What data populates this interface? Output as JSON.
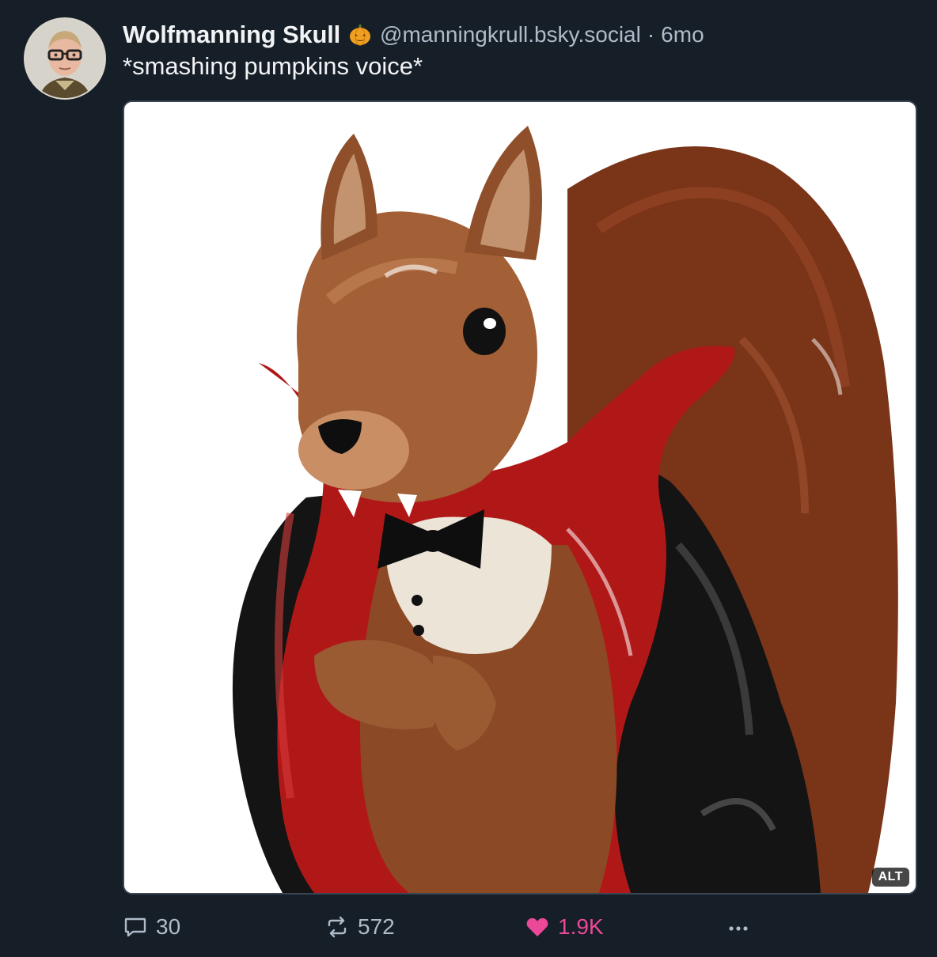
{
  "post": {
    "author": {
      "display_name": "Wolfmanning Skull",
      "handle": "@manningkrull.bsky.social",
      "badge_icon": "pumpkin-icon"
    },
    "separator": "·",
    "timestamp": "6mo",
    "text": "*smashing pumpkins voice*",
    "image": {
      "subject": "ceramic squirrel figurine in vampire cape with bow tie",
      "alt_badge": "ALT"
    },
    "actions": {
      "reply": {
        "icon": "speech-bubble-icon",
        "count": "30"
      },
      "repost": {
        "icon": "repost-arrows-icon",
        "count": "572"
      },
      "like": {
        "icon": "heart-icon",
        "count": "1.9K",
        "active": true,
        "color": "#ec4899"
      },
      "more": {
        "icon": "ellipsis-icon"
      }
    }
  },
  "colors": {
    "background": "#161e27",
    "text_primary": "#f1f3f5",
    "text_secondary": "#aebbc9",
    "like_active": "#ec4899"
  }
}
